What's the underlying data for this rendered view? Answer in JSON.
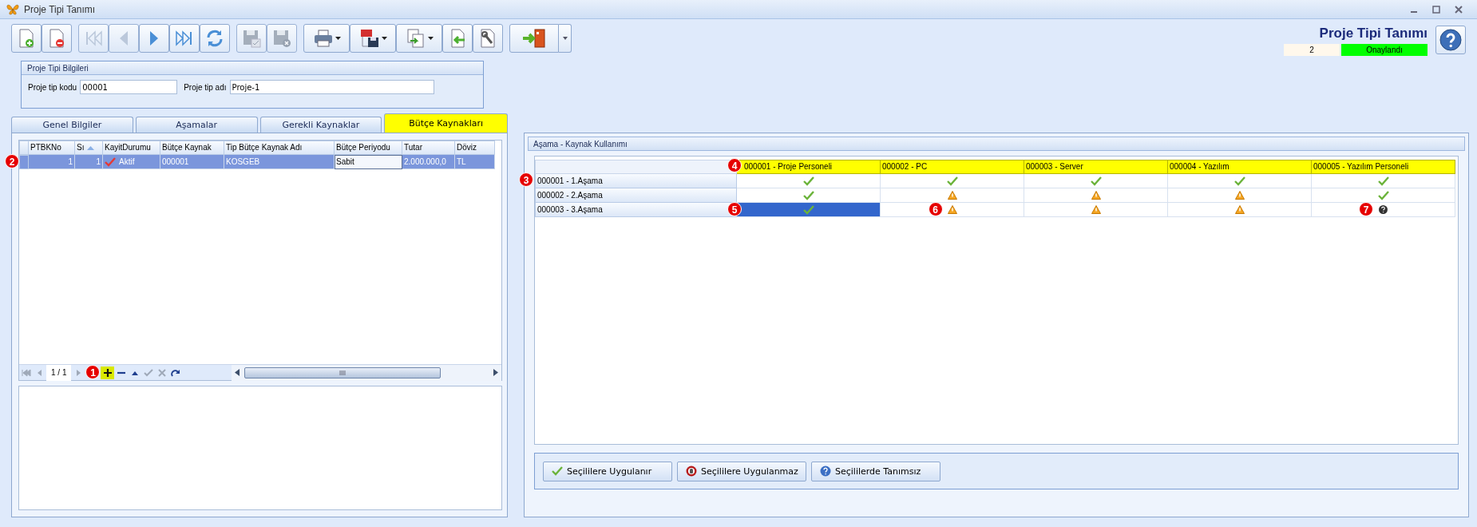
{
  "window": {
    "title": "Proje Tipi Tanımı"
  },
  "toolbar": [
    [
      {
        "kind": "new",
        "disabled": false,
        "dropdown": false
      },
      {
        "kind": "delete",
        "disabled": false,
        "dropdown": false
      }
    ],
    [
      {
        "kind": "first",
        "disabled": true,
        "dropdown": false
      },
      {
        "kind": "prev",
        "disabled": true,
        "dropdown": false
      },
      {
        "kind": "next",
        "disabled": false,
        "dropdown": false
      },
      {
        "kind": "last",
        "disabled": false,
        "dropdown": false
      },
      {
        "kind": "refresh",
        "disabled": false,
        "dropdown": false
      }
    ],
    [
      {
        "kind": "save",
        "disabled": true,
        "dropdown": false
      },
      {
        "kind": "cancel",
        "disabled": true,
        "dropdown": false
      }
    ],
    [
      {
        "kind": "print",
        "disabled": false,
        "dropdown": true
      },
      {
        "kind": "pdf",
        "disabled": false,
        "dropdown": true
      },
      {
        "kind": "export",
        "disabled": false,
        "dropdown": true
      },
      {
        "kind": "import",
        "disabled": false,
        "dropdown": false
      },
      {
        "kind": "wrench",
        "disabled": false,
        "dropdown": false
      }
    ],
    [
      {
        "kind": "exit",
        "disabled": false,
        "dropdown": true
      }
    ]
  ],
  "header": {
    "title": "Proje Tipi Tanımı",
    "number": "2",
    "status": "Onaylandı"
  },
  "info": {
    "title": "Proje Tipi Bilgileri",
    "fields": [
      {
        "label": "Proje tip kodu",
        "value": "00001"
      },
      {
        "label": "Proje tip adı",
        "value": "Proje-1"
      }
    ]
  },
  "tabs": [
    {
      "label": "Genel Bilgiler",
      "selected": false
    },
    {
      "label": "Aşamalar",
      "selected": false
    },
    {
      "label": "Gerekli Kaynaklar",
      "selected": false
    },
    {
      "label": "Bütçe Kaynakları",
      "selected": true
    }
  ],
  "grid": {
    "columns": [
      {
        "label": "PTBKNo",
        "sorted": false
      },
      {
        "label": "Sı",
        "sorted": true
      },
      {
        "label": "KayitDurumu",
        "sorted": false
      },
      {
        "label": "Bütçe Kaynak",
        "sorted": false
      },
      {
        "label": "Tip Bütçe Kaynak Adı",
        "sorted": false
      },
      {
        "label": "Bütçe Periyodu",
        "sorted": false
      },
      {
        "label": "Tutar",
        "sorted": false
      },
      {
        "label": "Döviz",
        "sorted": false
      }
    ],
    "rows": [
      {
        "selected": true,
        "callout": "2",
        "cells": [
          {
            "kind": "number",
            "text": "1",
            "focused": false
          },
          {
            "kind": "number",
            "text": "1",
            "focused": false
          },
          {
            "kind": "status",
            "text": "Aktif",
            "focused": false
          },
          {
            "kind": "text",
            "text": "000001",
            "focused": false
          },
          {
            "kind": "text",
            "text": "KOSGEB",
            "focused": false
          },
          {
            "kind": "text",
            "text": "Sabit",
            "focused": true
          },
          {
            "kind": "text",
            "text": "2.000.000,0",
            "focused": false
          },
          {
            "kind": "text",
            "text": "TL",
            "focused": false
          }
        ]
      }
    ]
  },
  "navigator": {
    "pager": "1 / 1",
    "callout": "1",
    "buttons": [
      {
        "kind": "first",
        "disabled": true,
        "highlighted": false
      },
      {
        "kind": "prev",
        "disabled": true,
        "highlighted": false
      },
      {
        "kind": "pager"
      },
      {
        "kind": "next",
        "disabled": true,
        "highlighted": false
      },
      {
        "kind": "add",
        "disabled": false,
        "highlighted": true
      },
      {
        "kind": "remove",
        "disabled": false,
        "highlighted": false
      },
      {
        "kind": "up",
        "disabled": false,
        "highlighted": false
      },
      {
        "kind": "check",
        "disabled": true,
        "highlighted": false
      },
      {
        "kind": "cancel",
        "disabled": true,
        "highlighted": false
      },
      {
        "kind": "redo",
        "disabled": false,
        "highlighted": false
      }
    ]
  },
  "matrix": {
    "title": "Aşama - Kaynak Kullanımı",
    "columns": [
      {
        "label": "000001 - Proje Personeli",
        "callout": "4"
      },
      {
        "label": "000002 - PC"
      },
      {
        "label": "000003 - Server"
      },
      {
        "label": "000004 - Yazılım"
      },
      {
        "label": "000005 - Yazılım Personeli"
      }
    ],
    "rows": [
      {
        "label": "000001 - 1.Aşama",
        "callout": "3",
        "cells": [
          {
            "kind": "check",
            "selected": false
          },
          {
            "kind": "check",
            "selected": false
          },
          {
            "kind": "check",
            "selected": false
          },
          {
            "kind": "check",
            "selected": false
          },
          {
            "kind": "check",
            "selected": false
          }
        ]
      },
      {
        "label": "000002 - 2.Aşama",
        "cells": [
          {
            "kind": "check",
            "selected": false
          },
          {
            "kind": "warning",
            "selected": false
          },
          {
            "kind": "warning",
            "selected": false
          },
          {
            "kind": "warning",
            "selected": false
          },
          {
            "kind": "check",
            "selected": false
          }
        ]
      },
      {
        "label": "000003 - 3.Aşama",
        "callout_end": "5",
        "cells": [
          {
            "kind": "check",
            "selected": true
          },
          {
            "kind": "warning",
            "selected": false,
            "callout": "6"
          },
          {
            "kind": "warning",
            "selected": false
          },
          {
            "kind": "warning",
            "selected": false
          },
          {
            "kind": "unknown",
            "selected": false,
            "callout": "7"
          }
        ]
      }
    ]
  },
  "actions": [
    {
      "kind": "apply",
      "label": "Seçililere Uygulanır"
    },
    {
      "kind": "deny",
      "label": "Seçililere Uygulanmaz"
    },
    {
      "kind": "undefined",
      "label": "Seçililerde Tanımsız"
    }
  ]
}
